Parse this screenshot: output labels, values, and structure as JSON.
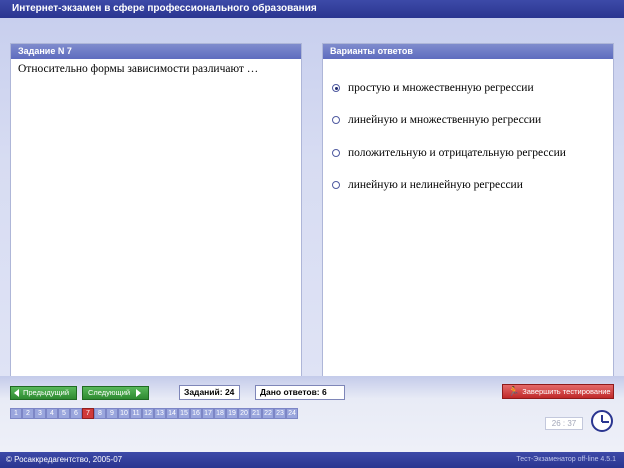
{
  "window": {
    "title": "Интернет-экзамен в сфере профессионального образования"
  },
  "question_panel": {
    "header": "Задание N 7",
    "text": "Относительно формы зависимости различают …"
  },
  "answers_panel": {
    "header": "Варианты ответов",
    "options": [
      {
        "label": "простую и множественную регрессии",
        "selected": true
      },
      {
        "label": "линейную и множественную регрессии",
        "selected": false
      },
      {
        "label": "положительную и отрицательную регрессии",
        "selected": false
      },
      {
        "label": "линейную и нелинейную регрессии",
        "selected": false
      }
    ]
  },
  "navigation": {
    "prev_label": "Предыдущий",
    "next_label": "Следующий",
    "tasks_count": "Заданий: 24",
    "answers_given": "Дано ответов: 6",
    "finish_label": "Завершить тестирование",
    "pages": [
      "1",
      "2",
      "3",
      "4",
      "5",
      "6",
      "7",
      "8",
      "9",
      "10",
      "11",
      "12",
      "13",
      "14",
      "15",
      "16",
      "17",
      "18",
      "19",
      "20",
      "21",
      "22",
      "23",
      "24"
    ],
    "current_page": "7",
    "time": "26 : 37"
  },
  "footer": {
    "copyright": "© Росаккредагентство, 2005-07",
    "version": "Тест-Экзаменатор off-line 4.5.1"
  },
  "icons": {
    "prev": "arrow-left-icon",
    "next": "arrow-right-icon",
    "finish": "runner-icon",
    "clock": "clock-icon"
  }
}
